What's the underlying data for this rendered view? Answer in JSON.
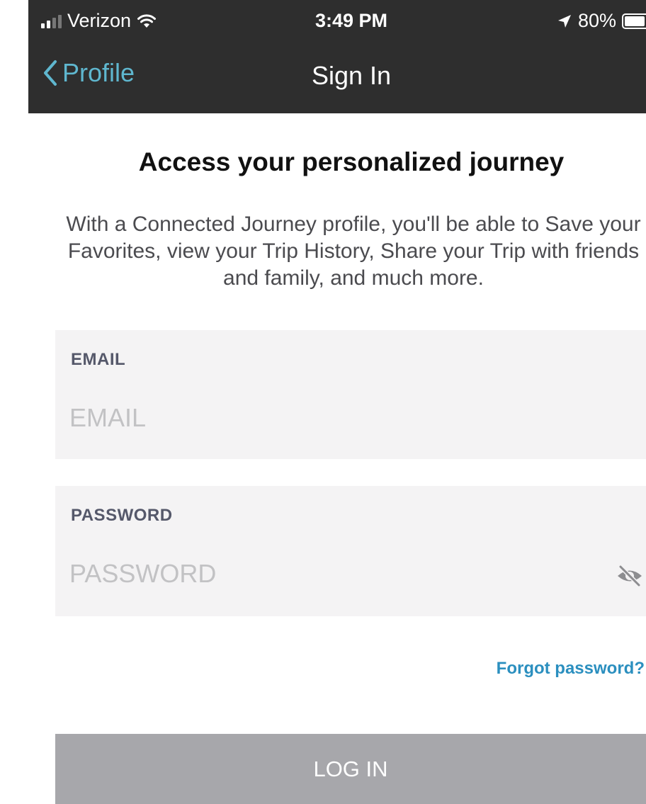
{
  "status_bar": {
    "carrier": "Verizon",
    "time": "3:49 PM",
    "battery": "80%",
    "battery_level": 0.8
  },
  "nav": {
    "back_label": "Profile",
    "title": "Sign In"
  },
  "content": {
    "headline": "Access your personalized journey",
    "description": "With a Connected Journey profile, you'll be able to Save your Favorites, view your Trip History, Share your Trip with friends and family, and much more."
  },
  "form": {
    "email": {
      "label": "EMAIL",
      "placeholder": "EMAIL",
      "value": ""
    },
    "password": {
      "label": "PASSWORD",
      "placeholder": "PASSWORD",
      "value": ""
    },
    "forgot_password": "Forgot password?",
    "login_label": "LOG IN"
  },
  "icons": {
    "back": "chevron-left-icon",
    "visibility": "eye-off-icon",
    "signal": "cellular-signal-icon",
    "wifi": "wifi-icon",
    "location": "location-arrow-icon",
    "battery": "battery-icon"
  },
  "colors": {
    "nav_background": "#2e2e2e",
    "accent": "#5fb7cf",
    "link": "#2b8fbf",
    "field_background": "#f4f3f4",
    "button_disabled": "#a7a7ab"
  }
}
